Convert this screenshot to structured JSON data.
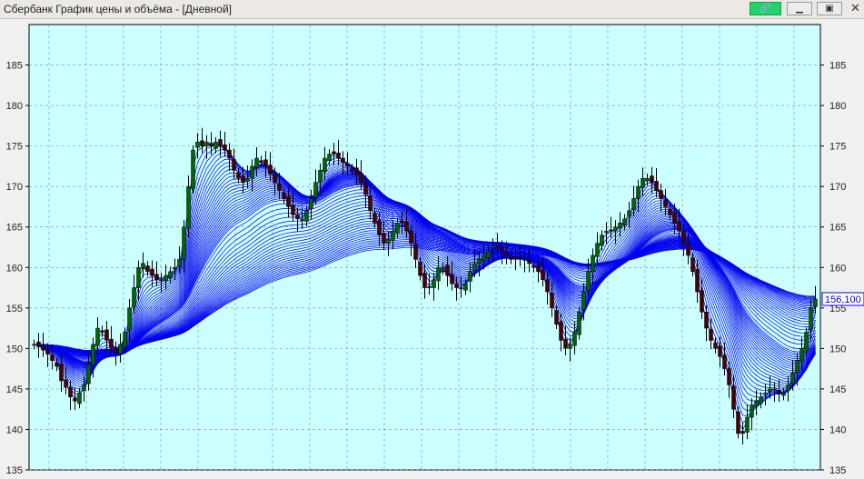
{
  "window": {
    "title": "Сбербанк График цены и объёма - [Дневной]",
    "buttons": {
      "link_icon": "link-icon",
      "minimize_icon": "minimize-icon",
      "restore_icon": "restore-icon",
      "close_icon": "close-icon"
    }
  },
  "colors": {
    "plot_bg": "#ccffff",
    "grid": "#8a8a8a",
    "ma_lines": "#0000ee",
    "candle_down": "#4a0000",
    "candle_up": "#006600",
    "last_price_box": "#0000ee"
  },
  "chart_data": {
    "type": "candlestick",
    "title": "",
    "xlabel": "",
    "ylabel": "",
    "ylim": [
      135,
      190
    ],
    "y_ticks": [
      135,
      140,
      145,
      150,
      155,
      160,
      165,
      170,
      175,
      180,
      185
    ],
    "y_tick_labels": [
      "135",
      "140",
      "145",
      "150",
      "155",
      "160",
      "165",
      "170",
      "175",
      "180",
      "185"
    ],
    "grid": true,
    "last_price": 156.1,
    "last_price_label": "156,100",
    "overlay": "ribbon of moving averages",
    "closes": [
      150.5,
      150.2,
      149.8,
      149.3,
      148.5,
      147.8,
      146.0,
      145.2,
      144.0,
      143.5,
      144.5,
      145.5,
      148.0,
      150.5,
      152.5,
      152.0,
      151.0,
      150.0,
      149.5,
      150.5,
      152.0,
      155.0,
      157.5,
      160.0,
      160.5,
      159.5,
      159.0,
      158.5,
      158.5,
      159.0,
      159.5,
      160.0,
      161.0,
      165.0,
      170.0,
      174.5,
      175.5,
      175.0,
      175.5,
      175.0,
      175.5,
      175.0,
      174.5,
      173.5,
      172.0,
      171.0,
      170.5,
      171.0,
      172.5,
      173.5,
      173.0,
      172.5,
      171.5,
      170.5,
      169.5,
      168.5,
      167.5,
      166.5,
      166.0,
      166.0,
      167.0,
      168.5,
      170.5,
      172.0,
      173.5,
      174.0,
      174.0,
      173.5,
      173.0,
      172.5,
      172.0,
      171.5,
      170.5,
      169.0,
      167.0,
      165.5,
      164.0,
      163.0,
      163.5,
      164.5,
      165.5,
      165.5,
      164.5,
      163.0,
      161.0,
      159.0,
      157.5,
      157.5,
      158.5,
      160.0,
      160.0,
      159.0,
      158.0,
      157.5,
      157.5,
      158.0,
      159.5,
      160.5,
      161.0,
      161.5,
      162.0,
      162.5,
      162.5,
      162.0,
      161.5,
      161.0,
      161.0,
      161.0,
      161.0,
      160.5,
      160.0,
      159.5,
      158.5,
      157.0,
      155.0,
      153.0,
      151.0,
      150.0,
      150.5,
      152.0,
      154.5,
      157.0,
      159.5,
      161.5,
      163.0,
      164.0,
      164.5,
      164.5,
      165.0,
      165.5,
      166.0,
      167.0,
      168.5,
      170.0,
      171.0,
      171.0,
      170.5,
      169.5,
      168.5,
      167.5,
      166.5,
      165.5,
      164.5,
      163.0,
      161.5,
      159.5,
      157.0,
      154.5,
      152.5,
      151.0,
      150.0,
      149.0,
      147.5,
      145.5,
      142.5,
      139.5,
      139.5,
      141.5,
      143.0,
      143.5,
      144.0,
      144.5,
      145.0,
      145.0,
      144.5,
      144.5,
      145.5,
      147.0,
      148.5,
      150.0,
      152.0,
      155.0,
      156.1
    ]
  }
}
